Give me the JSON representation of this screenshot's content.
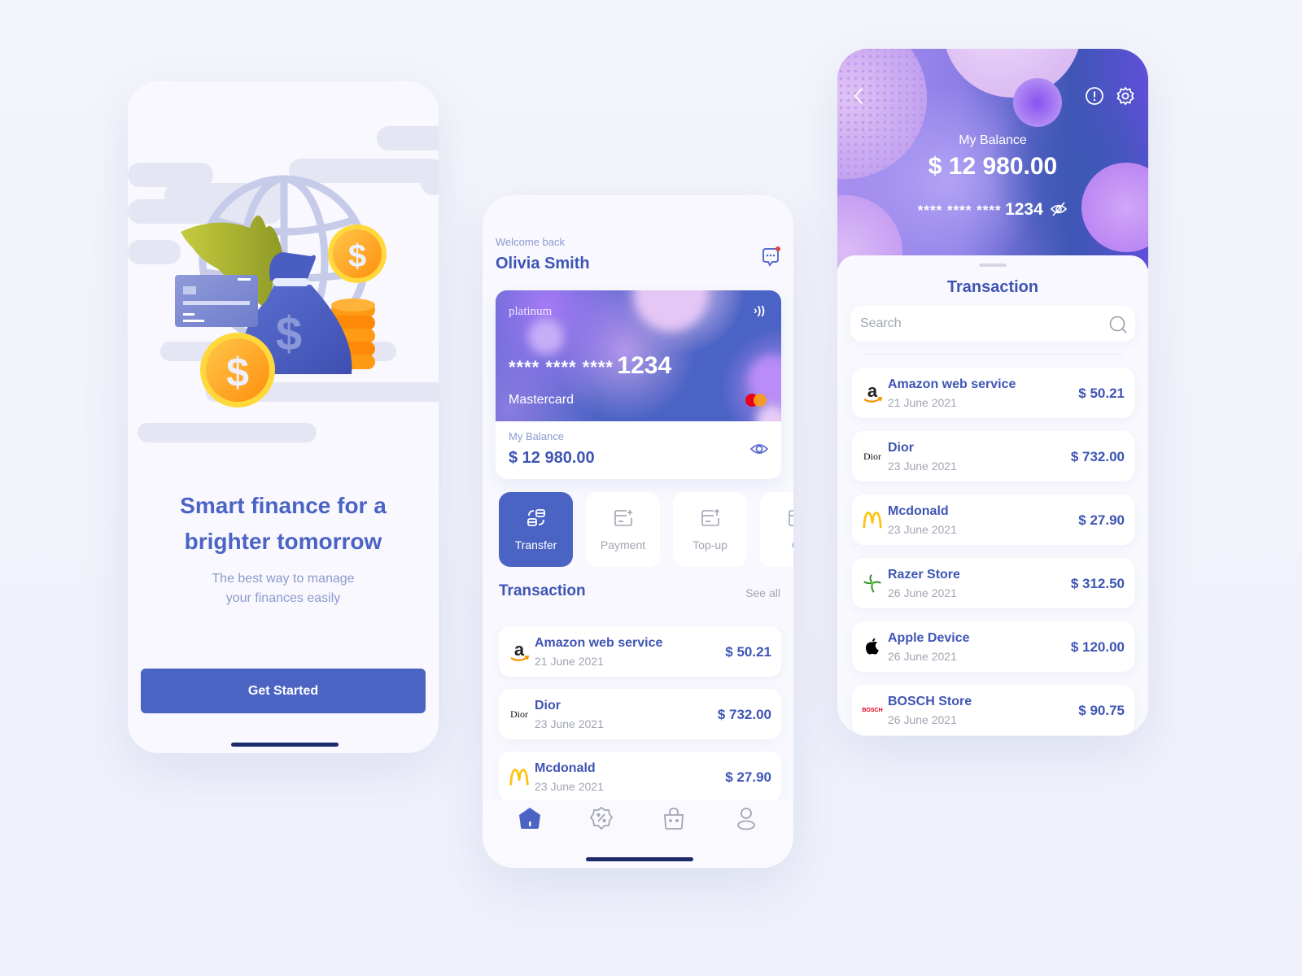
{
  "colors": {
    "primary": "#4b64c3",
    "heading": "#3f55b4",
    "muted": "#8c9acd",
    "gray": "#a1a5b3",
    "coin": "#ffa51f",
    "leaf": "#b5bf36"
  },
  "onboarding": {
    "title_line1": "Smart finance for a",
    "title_line2": "brighter tomorrow",
    "subtitle_line1": "The best way to manage",
    "subtitle_line2": "your finances easily",
    "cta_label": "Get Started"
  },
  "home": {
    "welcome": "Welcome back",
    "user_name": "Olivia Smith",
    "card": {
      "brand": "platinum",
      "number_masked": "**** **** ****",
      "number_last": "1234",
      "network": "Mastercard",
      "balance_label": "My Balance",
      "balance": "$ 12 980.00"
    },
    "actions": [
      {
        "label": "Transfer",
        "icon": "transfer-icon",
        "active": true
      },
      {
        "label": "Payment",
        "icon": "payment-icon",
        "active": false
      },
      {
        "label": "Top-up",
        "icon": "topup-icon",
        "active": false
      },
      {
        "label": "Cl",
        "icon": "card-icon",
        "active": false
      }
    ],
    "transactions_title": "Transaction",
    "see_all": "See all",
    "transactions": [
      {
        "merchant": "Amazon web service",
        "date": "21 June 2021",
        "amount": "$ 50.21",
        "logo": "amazon"
      },
      {
        "merchant": "Dior",
        "date": "23 June 2021",
        "amount": "$ 732.00",
        "logo": "dior"
      },
      {
        "merchant": "Mcdonald",
        "date": "23 June 2021",
        "amount": "$ 27.90",
        "logo": "mcdonald"
      }
    ],
    "nav": [
      {
        "name": "home",
        "icon": "home-icon",
        "active": true
      },
      {
        "name": "promo",
        "icon": "discount-badge-icon",
        "active": false
      },
      {
        "name": "shop",
        "icon": "shopping-bag-icon",
        "active": false
      },
      {
        "name": "profile",
        "icon": "user-icon",
        "active": false
      }
    ]
  },
  "detail": {
    "balance_label": "My Balance",
    "balance": "$ 12 980.00",
    "number_masked": "**** **** ****",
    "number_last": "1234",
    "sheet_title": "Transaction",
    "search_placeholder": "Search",
    "transactions": [
      {
        "merchant": "Amazon web service",
        "date": "21 June 2021",
        "amount": "$ 50.21",
        "logo": "amazon"
      },
      {
        "merchant": "Dior",
        "date": "23 June 2021",
        "amount": "$ 732.00",
        "logo": "dior"
      },
      {
        "merchant": "Mcdonald",
        "date": "23 June 2021",
        "amount": "$ 27.90",
        "logo": "mcdonald"
      },
      {
        "merchant": "Razer Store",
        "date": "26 June 2021",
        "amount": "$ 312.50",
        "logo": "razer"
      },
      {
        "merchant": "Apple Device",
        "date": "26 June 2021",
        "amount": "$ 120.00",
        "logo": "apple"
      },
      {
        "merchant": "BOSCH Store",
        "date": "26 June 2021",
        "amount": "$ 90.75",
        "logo": "bosch"
      }
    ],
    "logo_text": {
      "amazon": "a",
      "dior": "Dior",
      "bosch": "BOSCH"
    }
  }
}
